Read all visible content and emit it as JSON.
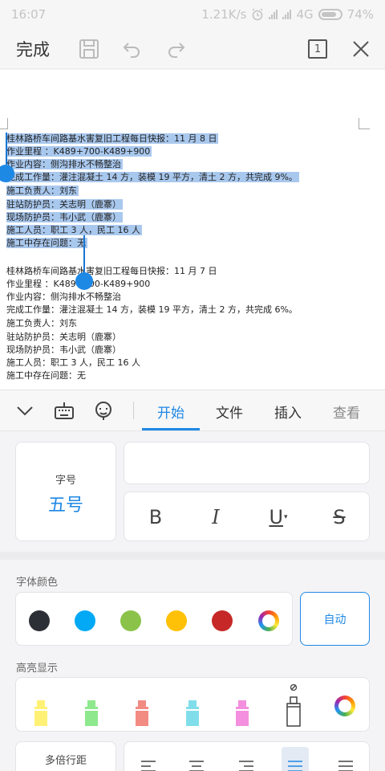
{
  "status_bar": {
    "time": "16:07",
    "speed": "1.21K/s",
    "network": "4G",
    "battery": "74%"
  },
  "toolbar": {
    "done_label": "完成",
    "page_count": "1"
  },
  "document": {
    "selected_lines": [
      "桂林路桥车间路基水害复旧工程每日快报：11 月 8 日",
      "作业里程 ：K489+700-K489+900",
      "作业内容：侧沟排水不畅整治",
      "完成工作量：灌注混凝土 14 方，装模 19 平方，清土 2 方，共完成 9%。",
      "施工负责人：刘东",
      "驻站防护员：关志明（鹿寨）",
      "现场防护员：韦小武（鹿寨）",
      "施工人员：职工 3 人，民工 16 人",
      "施工中存在问题：无"
    ],
    "lines": [
      "桂林路桥车间路基水害复旧工程每日快报：11 月 7 日",
      "作业里程 ：K489+700-K489+900",
      "作业内容：侧沟排水不畅整治",
      "完成工作量：灌注混凝土 14 方，装模 19 平方，清土 2 方，共完成 6%。",
      "施工负责人：刘东",
      "驻站防护员：关志明（鹿寨）",
      "现场防护员：韦小武（鹿寨）",
      "施工人员：职工 3 人，民工 16 人",
      "施工中存在问题：无"
    ]
  },
  "tabs": [
    {
      "label": "开始",
      "active": true
    },
    {
      "label": "文件",
      "active": false
    },
    {
      "label": "插入",
      "active": false
    },
    {
      "label": "查看",
      "active": false
    }
  ],
  "format_panel": {
    "font_size_title": "字号",
    "font_size_value": "五号",
    "bold_label": "B",
    "italic_label": "I",
    "underline_label": "U",
    "strike_label": "S",
    "font_color_label": "字体颜色",
    "font_colors": [
      "#2d2f36",
      "#03a9f4",
      "#8bc34a",
      "#ffc107",
      "#c62828"
    ],
    "auto_label": "自动",
    "highlight_label": "高亮显示",
    "highlight_colors": [
      "#fff176",
      "#8ee88e",
      "#f28b82",
      "#80deea",
      "#f48fdf"
    ],
    "line_spacing_label": "多倍行距"
  },
  "colors": {
    "accent": "#1e88e5",
    "selection": "#a9c8ee"
  }
}
